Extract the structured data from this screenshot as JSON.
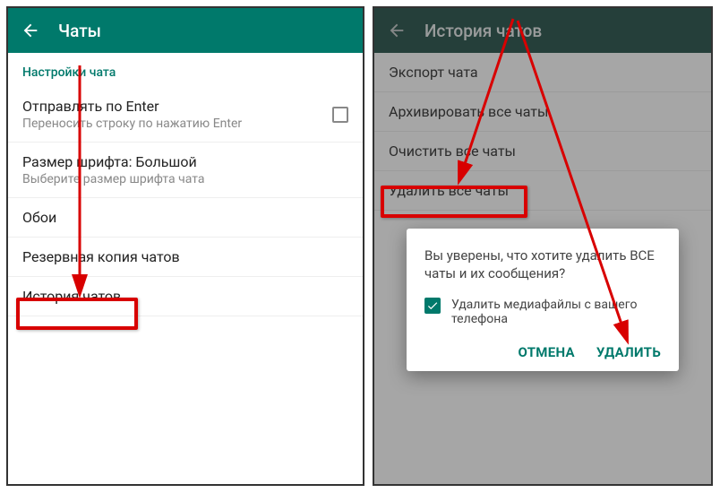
{
  "left": {
    "header_title": "Чаты",
    "section_label": "Настройки чата",
    "items": {
      "send_enter": {
        "primary": "Отправлять по Enter",
        "secondary": "Переносить строку по нажатию Enter"
      },
      "font_size": {
        "primary": "Размер шрифта: Большой",
        "secondary": "Выберите размер шрифта чата"
      },
      "wallpaper": {
        "primary": "Обои"
      },
      "backup": {
        "primary": "Резервная копия чатов"
      },
      "history": {
        "primary": "История чатов"
      }
    }
  },
  "right": {
    "header_title": "История чатов",
    "items": {
      "export": {
        "primary": "Экспорт чата"
      },
      "archive": {
        "primary": "Архивировать все чаты"
      },
      "clear": {
        "primary": "Очистить все чаты"
      },
      "delete": {
        "primary": "Удалить все чаты"
      }
    },
    "dialog": {
      "message": "Вы уверены, что хотите удалить ВСЕ чаты и их сообщения?",
      "media_label": "Удалить медиафайлы с вашего телефона",
      "cancel": "ОТМЕНА",
      "confirm": "УДАЛИТЬ"
    }
  }
}
